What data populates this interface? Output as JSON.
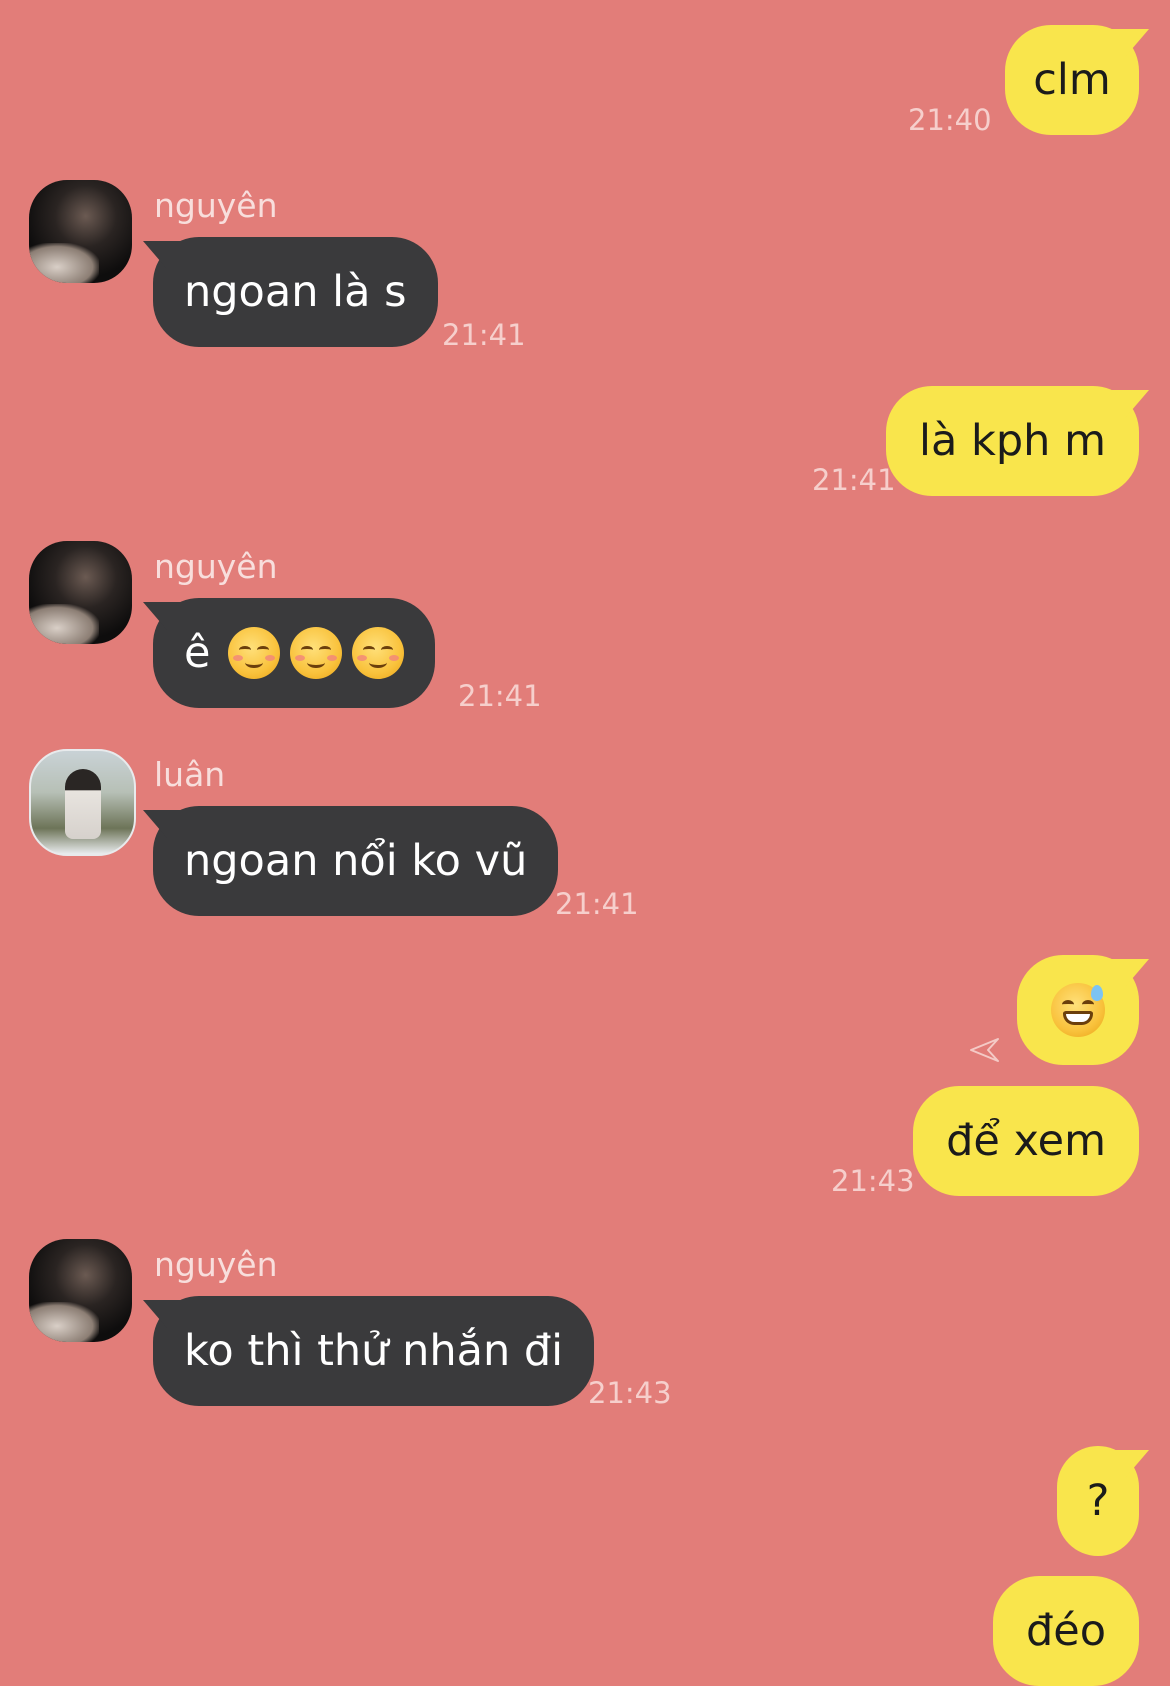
{
  "messages": [
    {
      "text": "clm",
      "time": "21:40"
    },
    {
      "sender": "nguyên",
      "text": "ngoan là s",
      "time": "21:41"
    },
    {
      "text": "là kph m",
      "time": "21:41"
    },
    {
      "sender": "nguyên",
      "text": "ê",
      "time": "21:41",
      "emojis": [
        "smiling-face-emoji",
        "smiling-face-emoji",
        "smiling-face-emoji"
      ]
    },
    {
      "sender": "luân",
      "text": "ngoan nổi ko vũ",
      "time": "21:41"
    },
    {
      "emoji": "grinning-sweat-emoji"
    },
    {
      "text": "để xem",
      "time": "21:43"
    },
    {
      "sender": "nguyên",
      "text": "ko thì thử nhắn đi",
      "time": "21:43"
    },
    {
      "text": "?"
    },
    {
      "text": "đéo"
    }
  ],
  "colors": {
    "background": "#e27d79",
    "outgoing_bubble": "#f9e54c",
    "incoming_bubble": "#3a3a3c"
  }
}
